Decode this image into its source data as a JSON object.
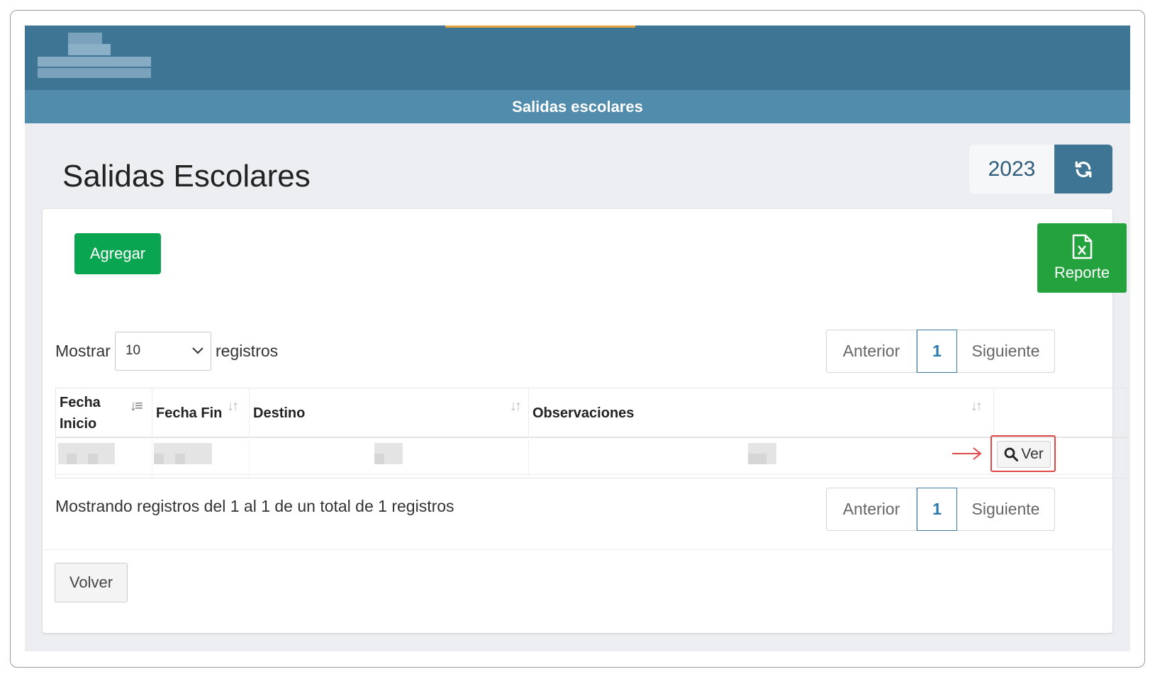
{
  "header": {
    "title": "Salidas escolares"
  },
  "page": {
    "title": "Salidas Escolares",
    "year": "2023"
  },
  "actions": {
    "add_label": "Agregar",
    "report_label": "Reporte",
    "back_label": "Volver",
    "view_label": "Ver"
  },
  "length_control": {
    "prefix": "Mostrar",
    "value": "10",
    "suffix": "registros"
  },
  "pagination": {
    "prev": "Anterior",
    "current": "1",
    "next": "Siguiente"
  },
  "table": {
    "columns": [
      {
        "label": "Fecha Inicio",
        "line1": "Fecha",
        "line2": "Inicio"
      },
      {
        "label": "Fecha Fin"
      },
      {
        "label": "Destino"
      },
      {
        "label": "Observaciones"
      }
    ]
  },
  "info_text": "Mostrando registros del 1 al 1 de un total de 1 registros",
  "colors": {
    "topbar": "#3e7494",
    "titlebar": "#528cad",
    "add_button": "#0aa550",
    "report_button": "#23a23e",
    "highlight": "#e04848"
  }
}
